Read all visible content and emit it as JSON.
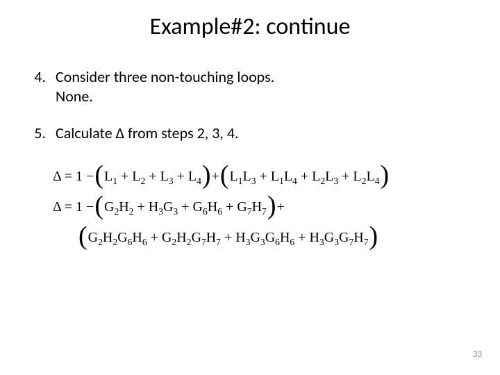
{
  "title": "Example#2: continue",
  "items": [
    {
      "num": "4.",
      "line1": "Consider three non-touching loops.",
      "line2": "None."
    },
    {
      "num": "5.",
      "line1": "Calculate Δ from steps 2, 3, 4."
    }
  ],
  "math": {
    "eq1": {
      "lhs": "Δ = 1 −",
      "g1": [
        "L",
        "1",
        " + L",
        "2",
        " + L",
        "3",
        " + L",
        "4"
      ],
      "mid": "+",
      "g2": [
        "L",
        "1",
        "L",
        "3",
        " + L",
        "1",
        "L",
        "4",
        " + L",
        "2",
        "L",
        "3",
        " + L",
        "2",
        "L",
        "4"
      ]
    },
    "eq2": {
      "lhs": "Δ = 1 −",
      "g1": [
        "G",
        "2",
        "H",
        "2",
        " + H",
        "3",
        "G",
        "3",
        " + G",
        "6",
        "H",
        "6",
        " + G",
        "7",
        "H",
        "7",
        "  "
      ],
      "mid": "+",
      "g2": [
        "G",
        "2",
        "H",
        "2",
        "G",
        "6",
        "H",
        "6",
        " + G",
        "2",
        "H",
        "2",
        "G",
        "7",
        "H",
        "7",
        " + H",
        "3",
        "G",
        "3",
        "G",
        "6",
        "H",
        "6",
        " + H",
        "3",
        "G",
        "3",
        "G",
        "7",
        "H",
        "7"
      ]
    }
  },
  "pagenum": "33"
}
